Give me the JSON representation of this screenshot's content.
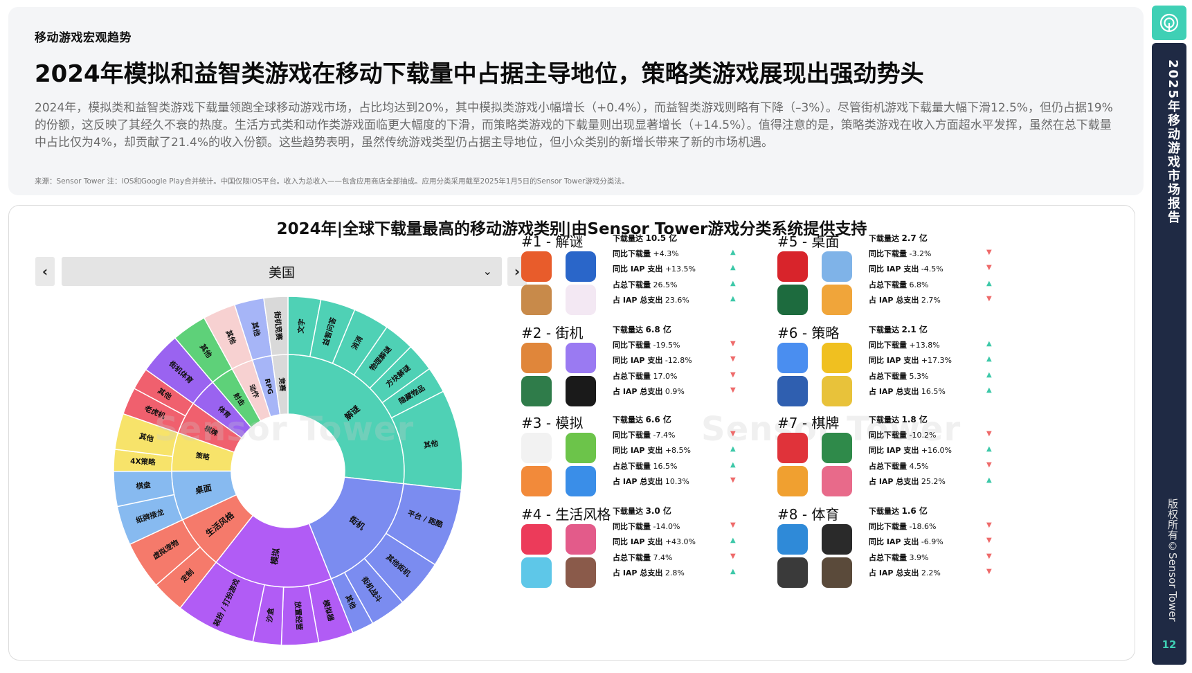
{
  "header": {
    "section_label": "移动游戏宏观趋势",
    "headline": "2024年模拟和益智类游戏在移动下载量中占据主导地位，策略类游戏展现出强劲势头",
    "summary": "2024年，模拟类和益智类游戏下载量领跑全球移动游戏市场，占比均达到20%，其中模拟类游戏小幅增长（+0.4%），而益智类游戏则略有下降（–3%）。尽管街机游戏下载量大幅下滑12.5%，但仍占据19%的份额，这反映了其经久不衰的热度。生活方式类和动作类游戏面临更大幅度的下滑，而策略类游戏的下载量则出现显著增长（+14.5%）。值得注意的是，策略类游戏在收入方面超水平发挥，虽然在总下载量中占比仅为4%，却贡献了21.4%的收入份额。这些趋势表明，虽然传统游戏类型仍占据主导地位，但小众类别的新增长带来了新的市场机遇。",
    "source": "来源：Sensor Tower 注：iOS和Google Play合并统计。中国仅限iOS平台。收入为总收入——包含应用商店全部抽成。应用分类采用截至2025年1月5日的Sensor Tower游戏分类法。"
  },
  "chart_title": "2024年|全球下载量最高的移动游戏类别|由Sensor Tower游戏分类系统提供支持",
  "selector": {
    "prev": "‹",
    "next": "›",
    "region": "美国",
    "chevron": "⌄"
  },
  "watermark": "Sensor Tower",
  "sidebar": {
    "title": "2025年移动游戏市场报告",
    "copyright": "版权所有©Sensor Tower",
    "page": "12"
  },
  "labels": {
    "downloads": "下载量达",
    "yoy_dl": "同比下载量",
    "yoy_iap": "同比 IAP 支出",
    "share_dl": "占总下载量",
    "share_iap": "占 IAP 总支出"
  },
  "colors": {
    "puzzle": "#4fd1b5",
    "arcade": "#7b8cf0",
    "simulation": "#b15cf5",
    "lifestyle": "#f57a6b",
    "tabletop": "#87baf0",
    "strategy": "#f7e36a",
    "casino": "#f0606e",
    "sports": "#9a63f0",
    "shooter": "#5ed179",
    "action": "#f7d1d1",
    "rpg": "#a6b5f7",
    "racing": "#d9d9d9",
    "up": "#3cc8a8",
    "down": "#ee6a6a"
  },
  "chart_data": {
    "type": "sunburst",
    "inner": [
      {
        "name": "解谜",
        "value": 26.5,
        "color": "#4fd1b5"
      },
      {
        "name": "街机",
        "value": 17.0,
        "color": "#7b8cf0"
      },
      {
        "name": "模拟",
        "value": 16.5,
        "color": "#b15cf5"
      },
      {
        "name": "生活风格",
        "value": 7.4,
        "color": "#f57a6b"
      },
      {
        "name": "桌面",
        "value": 6.8,
        "color": "#87baf0"
      },
      {
        "name": "策略",
        "value": 5.3,
        "color": "#f7e36a"
      },
      {
        "name": "棋牌",
        "value": 4.5,
        "color": "#f0606e"
      },
      {
        "name": "体育",
        "value": 3.9,
        "color": "#9a63f0"
      },
      {
        "name": "射击",
        "value": 3.2,
        "color": "#5ed179"
      },
      {
        "name": "动作",
        "value": 3.0,
        "color": "#f7d1d1"
      },
      {
        "name": "RPG",
        "value": 2.7,
        "color": "#a6b5f7"
      },
      {
        "name": "竞赛",
        "value": 2.2,
        "color": "#d9d9d9"
      }
    ],
    "outer": [
      {
        "name": "文字",
        "parent": "解谜",
        "value": 3.0
      },
      {
        "name": "益智问答",
        "parent": "解谜",
        "value": 3.2
      },
      {
        "name": "消消",
        "parent": "解谜",
        "value": 3.3
      },
      {
        "name": "物理解谜",
        "parent": "解谜",
        "value": 2.8
      },
      {
        "name": "方块解谜",
        "parent": "解谜",
        "value": 2.6
      },
      {
        "name": "隐藏物品",
        "parent": "解谜",
        "value": 2.4
      },
      {
        "name": "其他",
        "parent": "解谜",
        "value": 9.2
      },
      {
        "name": "平台 / 跑酷",
        "parent": "街机",
        "value": 7.2
      },
      {
        "name": "其他街机",
        "parent": "街机",
        "value": 4.5
      },
      {
        "name": "街机战斗",
        "parent": "街机",
        "value": 3.3
      },
      {
        "name": "其他",
        "parent": "街机",
        "value": 2.0
      },
      {
        "name": "模拟器",
        "parent": "模拟",
        "value": 3.2
      },
      {
        "name": "放置经营",
        "parent": "模拟",
        "value": 3.4
      },
      {
        "name": "沙盒",
        "parent": "模拟",
        "value": 2.6
      },
      {
        "name": "装扮 / 打扮游戏",
        "parent": "模拟",
        "value": 7.3
      },
      {
        "name": "定制",
        "parent": "生活风格",
        "value": 3.0
      },
      {
        "name": "虚拟宠物",
        "parent": "生活风格",
        "value": 4.4
      },
      {
        "name": "纸牌接龙",
        "parent": "桌面",
        "value": 3.6
      },
      {
        "name": "棋盘",
        "parent": "桌面",
        "value": 3.2
      },
      {
        "name": "4X策略",
        "parent": "策略",
        "value": 2.0
      },
      {
        "name": "其他",
        "parent": "策略",
        "value": 3.3
      },
      {
        "name": "老虎机",
        "parent": "棋牌",
        "value": 2.5
      },
      {
        "name": "其他",
        "parent": "棋牌",
        "value": 2.0
      },
      {
        "name": "街机体育",
        "parent": "体育",
        "value": 3.9
      },
      {
        "name": "其他",
        "parent": "射击",
        "value": 3.2
      },
      {
        "name": "其他",
        "parent": "动作",
        "value": 3.0
      },
      {
        "name": "其他",
        "parent": "RPG",
        "value": 2.7
      },
      {
        "name": "街机竞赛",
        "parent": "竞赛",
        "value": 2.2
      }
    ],
    "categories": [
      {
        "rank": "#1 - 解谜",
        "downloads": "10.5 亿",
        "yoy_dl": "+4.3%",
        "yoy_iap": "+13.5%",
        "share_dl": "26.5%",
        "share_iap": "23.6%",
        "dirs": [
          "up",
          "up",
          "up",
          "up"
        ],
        "icon_colors": [
          "#e85c2b",
          "#2a66c9",
          "#c88a4a",
          "#f3e8f3"
        ]
      },
      {
        "rank": "#2 - 街机",
        "downloads": "6.8 亿",
        "yoy_dl": "-19.5%",
        "yoy_iap": "-12.8%",
        "share_dl": "17.0%",
        "share_iap": "0.9%",
        "dirs": [
          "down",
          "down",
          "down",
          "down"
        ],
        "icon_colors": [
          "#e0863a",
          "#9a7af2",
          "#2f7c4a",
          "#1a1a1a"
        ]
      },
      {
        "rank": "#3 - 模拟",
        "downloads": "6.6 亿",
        "yoy_dl": "-7.4%",
        "yoy_iap": "+8.5%",
        "share_dl": "16.5%",
        "share_iap": "10.3%",
        "dirs": [
          "down",
          "up",
          "up",
          "down"
        ],
        "icon_colors": [
          "#f2f2f2",
          "#6cc44a",
          "#f28a3a",
          "#3a8ee8"
        ]
      },
      {
        "rank": "#4 - 生活风格",
        "downloads": "3.0 亿",
        "yoy_dl": "-14.0%",
        "yoy_iap": "+43.0%",
        "share_dl": "7.4%",
        "share_iap": "2.8%",
        "dirs": [
          "down",
          "up",
          "down",
          "up"
        ],
        "icon_colors": [
          "#ec3b5a",
          "#e35b8a",
          "#5ec7e8",
          "#8a5a4a"
        ]
      },
      {
        "rank": "#5 - 桌面",
        "downloads": "2.7 亿",
        "yoy_dl": "-3.2%",
        "yoy_iap": "-4.5%",
        "share_dl": "6.8%",
        "share_iap": "2.7%",
        "dirs": [
          "down",
          "down",
          "up",
          "down"
        ],
        "icon_colors": [
          "#d8242b",
          "#7fb3e8",
          "#1d6b3e",
          "#f0a53a"
        ]
      },
      {
        "rank": "#6 - 策略",
        "downloads": "2.1 亿",
        "yoy_dl": "+13.8%",
        "yoy_iap": "+17.3%",
        "share_dl": "5.3%",
        "share_iap": "16.5%",
        "dirs": [
          "up",
          "up",
          "up",
          "up"
        ],
        "icon_colors": [
          "#4a8ef0",
          "#f0c020",
          "#2f5fb0",
          "#e8c23a"
        ]
      },
      {
        "rank": "#7 - 棋牌",
        "downloads": "1.8 亿",
        "yoy_dl": "-10.2%",
        "yoy_iap": "+16.0%",
        "share_dl": "4.5%",
        "share_iap": "25.2%",
        "dirs": [
          "down",
          "up",
          "down",
          "up"
        ],
        "icon_colors": [
          "#e0333a",
          "#2f8a4a",
          "#f0a030",
          "#e86a8a"
        ]
      },
      {
        "rank": "#8 - 体育",
        "downloads": "1.6 亿",
        "yoy_dl": "-18.6%",
        "yoy_iap": "-6.9%",
        "share_dl": "3.9%",
        "share_iap": "2.2%",
        "dirs": [
          "down",
          "down",
          "down",
          "down"
        ],
        "icon_colors": [
          "#2f8ad8",
          "#2a2a2a",
          "#3a3a3a",
          "#5a4a3a"
        ]
      }
    ]
  }
}
